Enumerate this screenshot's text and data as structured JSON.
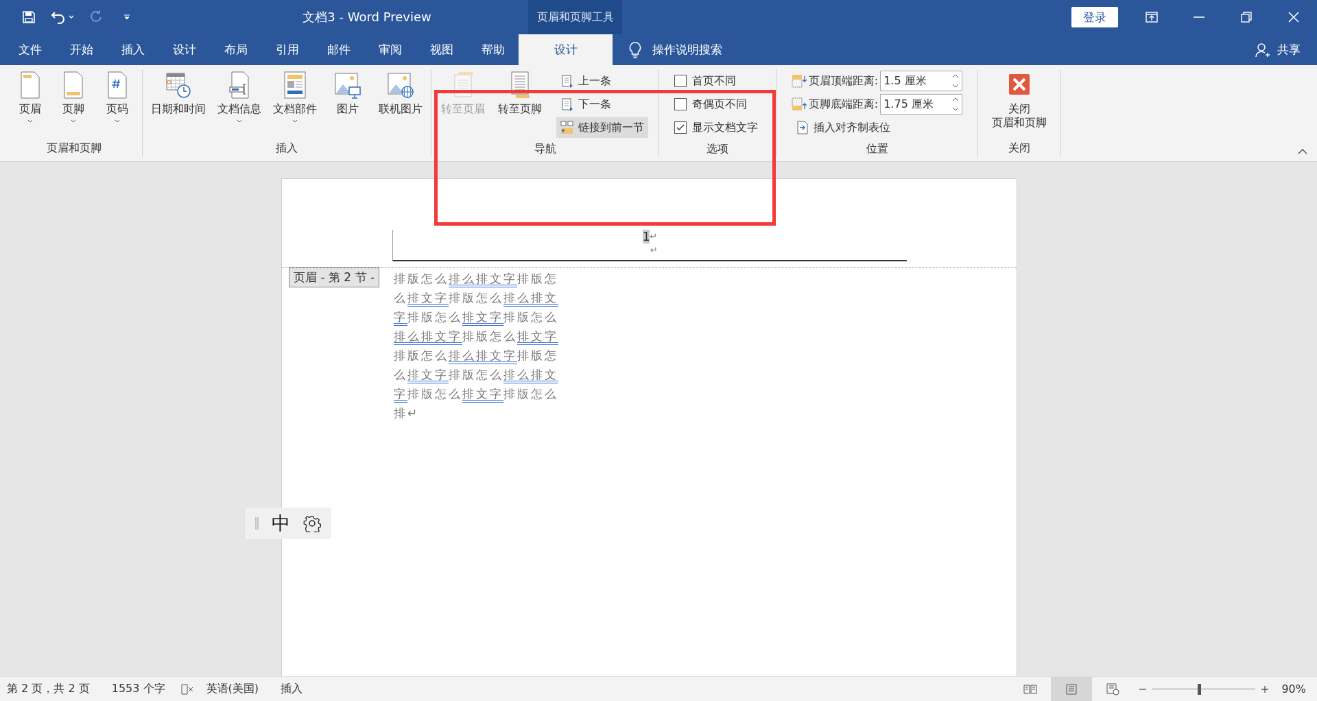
{
  "title_bar": {
    "title": "文档3  -  Word Preview",
    "contextual_label": "页眉和页脚工具",
    "sign_in": "登录"
  },
  "tabs": [
    {
      "label": "文件",
      "selected": false,
      "kind": "normal"
    },
    {
      "label": "开始",
      "selected": false,
      "kind": "normal"
    },
    {
      "label": "插入",
      "selected": false,
      "kind": "normal"
    },
    {
      "label": "设计",
      "selected": false,
      "kind": "normal"
    },
    {
      "label": "布局",
      "selected": false,
      "kind": "normal"
    },
    {
      "label": "引用",
      "selected": false,
      "kind": "normal"
    },
    {
      "label": "邮件",
      "selected": false,
      "kind": "normal"
    },
    {
      "label": "审阅",
      "selected": false,
      "kind": "normal"
    },
    {
      "label": "视图",
      "selected": false,
      "kind": "normal"
    },
    {
      "label": "帮助",
      "selected": false,
      "kind": "normal"
    },
    {
      "label": "设计",
      "selected": true,
      "kind": "contextual"
    }
  ],
  "tell_me": "操作说明搜索",
  "share": "共享",
  "ribbon": {
    "groups": [
      {
        "label": "页眉和页脚",
        "items": [
          {
            "kind": "large",
            "label": "页眉",
            "dropdown": true,
            "disabled": false
          },
          {
            "kind": "large",
            "label": "页脚",
            "dropdown": true,
            "disabled": false
          },
          {
            "kind": "large",
            "label": "页码",
            "dropdown": true,
            "disabled": false
          }
        ]
      },
      {
        "label": "插入",
        "items": [
          {
            "kind": "large",
            "label": "日期和时间",
            "dropdown": false,
            "disabled": false
          },
          {
            "kind": "large",
            "label": "文档信息",
            "dropdown": true,
            "disabled": false
          },
          {
            "kind": "large",
            "label": "文档部件",
            "dropdown": true,
            "disabled": false
          },
          {
            "kind": "large",
            "label": "图片",
            "dropdown": false,
            "disabled": false
          },
          {
            "kind": "large",
            "label": "联机图片",
            "dropdown": false,
            "disabled": false
          }
        ]
      },
      {
        "label": "导航",
        "items": [
          {
            "kind": "large",
            "label": "转至页眉",
            "dropdown": false,
            "disabled": true
          },
          {
            "kind": "large",
            "label": "转至页脚",
            "dropdown": false,
            "disabled": false
          },
          {
            "kind": "stack",
            "items": [
              {
                "kind": "small",
                "label": "上一条",
                "disabled": false,
                "on": false
              },
              {
                "kind": "small",
                "label": "下一条",
                "disabled": false,
                "on": false
              },
              {
                "kind": "small",
                "label": "链接到前一节",
                "disabled": false,
                "on": true
              }
            ]
          }
        ]
      },
      {
        "label": "选项",
        "items": [
          {
            "kind": "stack",
            "items": [
              {
                "kind": "checkbox",
                "label": "首页不同",
                "checked": false
              },
              {
                "kind": "checkbox",
                "label": "奇偶页不同",
                "checked": false
              },
              {
                "kind": "checkbox",
                "label": "显示文档文字",
                "checked": true
              }
            ]
          }
        ]
      },
      {
        "label": "位置",
        "items": [
          {
            "kind": "stack",
            "items": [
              {
                "kind": "spin",
                "label": "页眉顶端距离:",
                "value": "1.5 厘米"
              },
              {
                "kind": "spin",
                "label": "页脚底端距离:",
                "value": "1.75 厘米"
              },
              {
                "kind": "small",
                "label": "插入对齐制表位",
                "disabled": false,
                "on": false
              }
            ]
          }
        ]
      },
      {
        "label": "关闭",
        "items": [
          {
            "kind": "large",
            "label": "关闭",
            "second_line": "页眉和页脚",
            "dropdown": false,
            "disabled": false
          }
        ]
      }
    ]
  },
  "document": {
    "page_number": "1",
    "page_number_mark": "↵",
    "empty_line_mark": "↵",
    "header_label": "页眉 - 第 2 节 -",
    "body": [
      {
        "text": "排版怎么",
        "flagged": false
      },
      {
        "text": "排么排文字",
        "flagged": true
      },
      {
        "text": "排版怎么",
        "flagged": false
      },
      {
        "text": "排文字",
        "flagged": true
      },
      {
        "text": "排版怎么",
        "flagged": false
      },
      {
        "text": "排么排文字",
        "flagged": true
      },
      {
        "text": "排版怎么",
        "flagged": false
      },
      {
        "text": "排文字",
        "flagged": true
      },
      {
        "text": "排版怎么",
        "flagged": false
      },
      {
        "text": "排么排文字",
        "flagged": true
      },
      {
        "text": "排版怎么",
        "flagged": false
      },
      {
        "text": "排文字",
        "flagged": true
      },
      {
        "text": "排版怎么",
        "flagged": false
      },
      {
        "text": "排么排文字",
        "flagged": true
      },
      {
        "text": "排版怎么",
        "flagged": false
      },
      {
        "text": "排文字",
        "flagged": true
      },
      {
        "text": "排版怎么",
        "flagged": false
      },
      {
        "text": "排么排文字",
        "flagged": true
      },
      {
        "text": "排版怎么",
        "flagged": false
      },
      {
        "text": "排文字",
        "flagged": true
      },
      {
        "text": "排版怎么排↵",
        "flagged": false
      }
    ]
  },
  "ime_bar": {
    "mode": "中"
  },
  "status_bar": {
    "page": "第 2 页，共 2 页",
    "words": "1553 个字",
    "language": "英语(美国)",
    "mode": "插入",
    "views": [
      {
        "selected": false
      },
      {
        "selected": true
      },
      {
        "selected": false
      }
    ],
    "zoom": {
      "level": 0.45
    },
    "zoom_text": "90%"
  }
}
